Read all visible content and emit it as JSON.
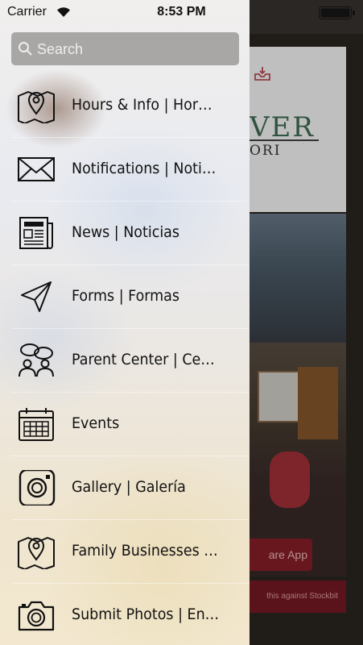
{
  "status_bar": {
    "carrier": "Carrier",
    "time": "8:53 PM"
  },
  "search": {
    "placeholder": "Search",
    "value": ""
  },
  "menu": {
    "items": [
      {
        "label": "Hours & Info | Horas y...",
        "icon": "map-pin-icon"
      },
      {
        "label": "Notifications | Notificaci...",
        "icon": "envelope-icon"
      },
      {
        "label": "News | Noticias",
        "icon": "newspaper-icon"
      },
      {
        "label": "Forms | Formas",
        "icon": "paper-plane-icon"
      },
      {
        "label": "Parent Center | Centro...",
        "icon": "chat-people-icon"
      },
      {
        "label": "Events",
        "icon": "calendar-icon"
      },
      {
        "label": "Gallery | Galería",
        "icon": "instagram-icon"
      },
      {
        "label": "Family Businesses | Ne...",
        "icon": "map-pin-icon"
      },
      {
        "label": "Submit Photos | Enviar...",
        "icon": "camera-icon"
      }
    ]
  },
  "background": {
    "brand_title": "VER",
    "brand_subtitle": "ORI",
    "share_button_label": "are App",
    "footer_text": "this against Stockbit"
  },
  "colors": {
    "brand_green": "#3f6f55",
    "share_red": "#8d1f2a",
    "search_bg": "#a9a7a6"
  }
}
